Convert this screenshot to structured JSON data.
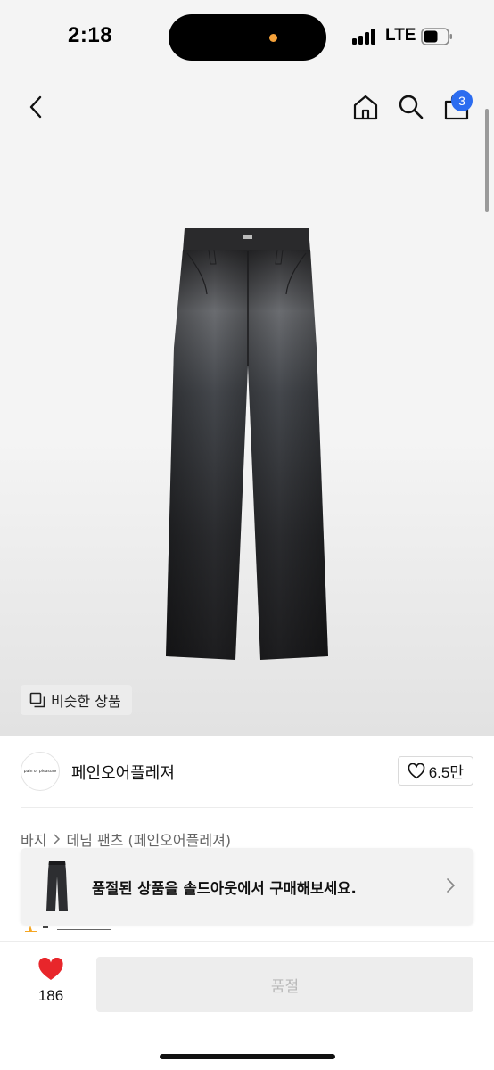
{
  "status_bar": {
    "time": "2:18",
    "network": "LTE"
  },
  "header": {
    "cart_count": "3"
  },
  "gallery": {
    "similar_label": "비슷한 상품"
  },
  "brand": {
    "logo_text": "pain or pleasure",
    "name": "페인오어플레져",
    "likes": "6.5만"
  },
  "breadcrumb": {
    "items": [
      "바지",
      "데님 팬츠 (페인오어플레져)"
    ]
  },
  "banner": {
    "text": "품절된 상품을 솔드아웃에서 구매해보세요."
  },
  "bottom_bar": {
    "wish_count": "186",
    "action_label": "품절"
  },
  "colors": {
    "badge": "#2b6cf0",
    "heart": "#e8262b",
    "disabled_button": "#ededed"
  }
}
